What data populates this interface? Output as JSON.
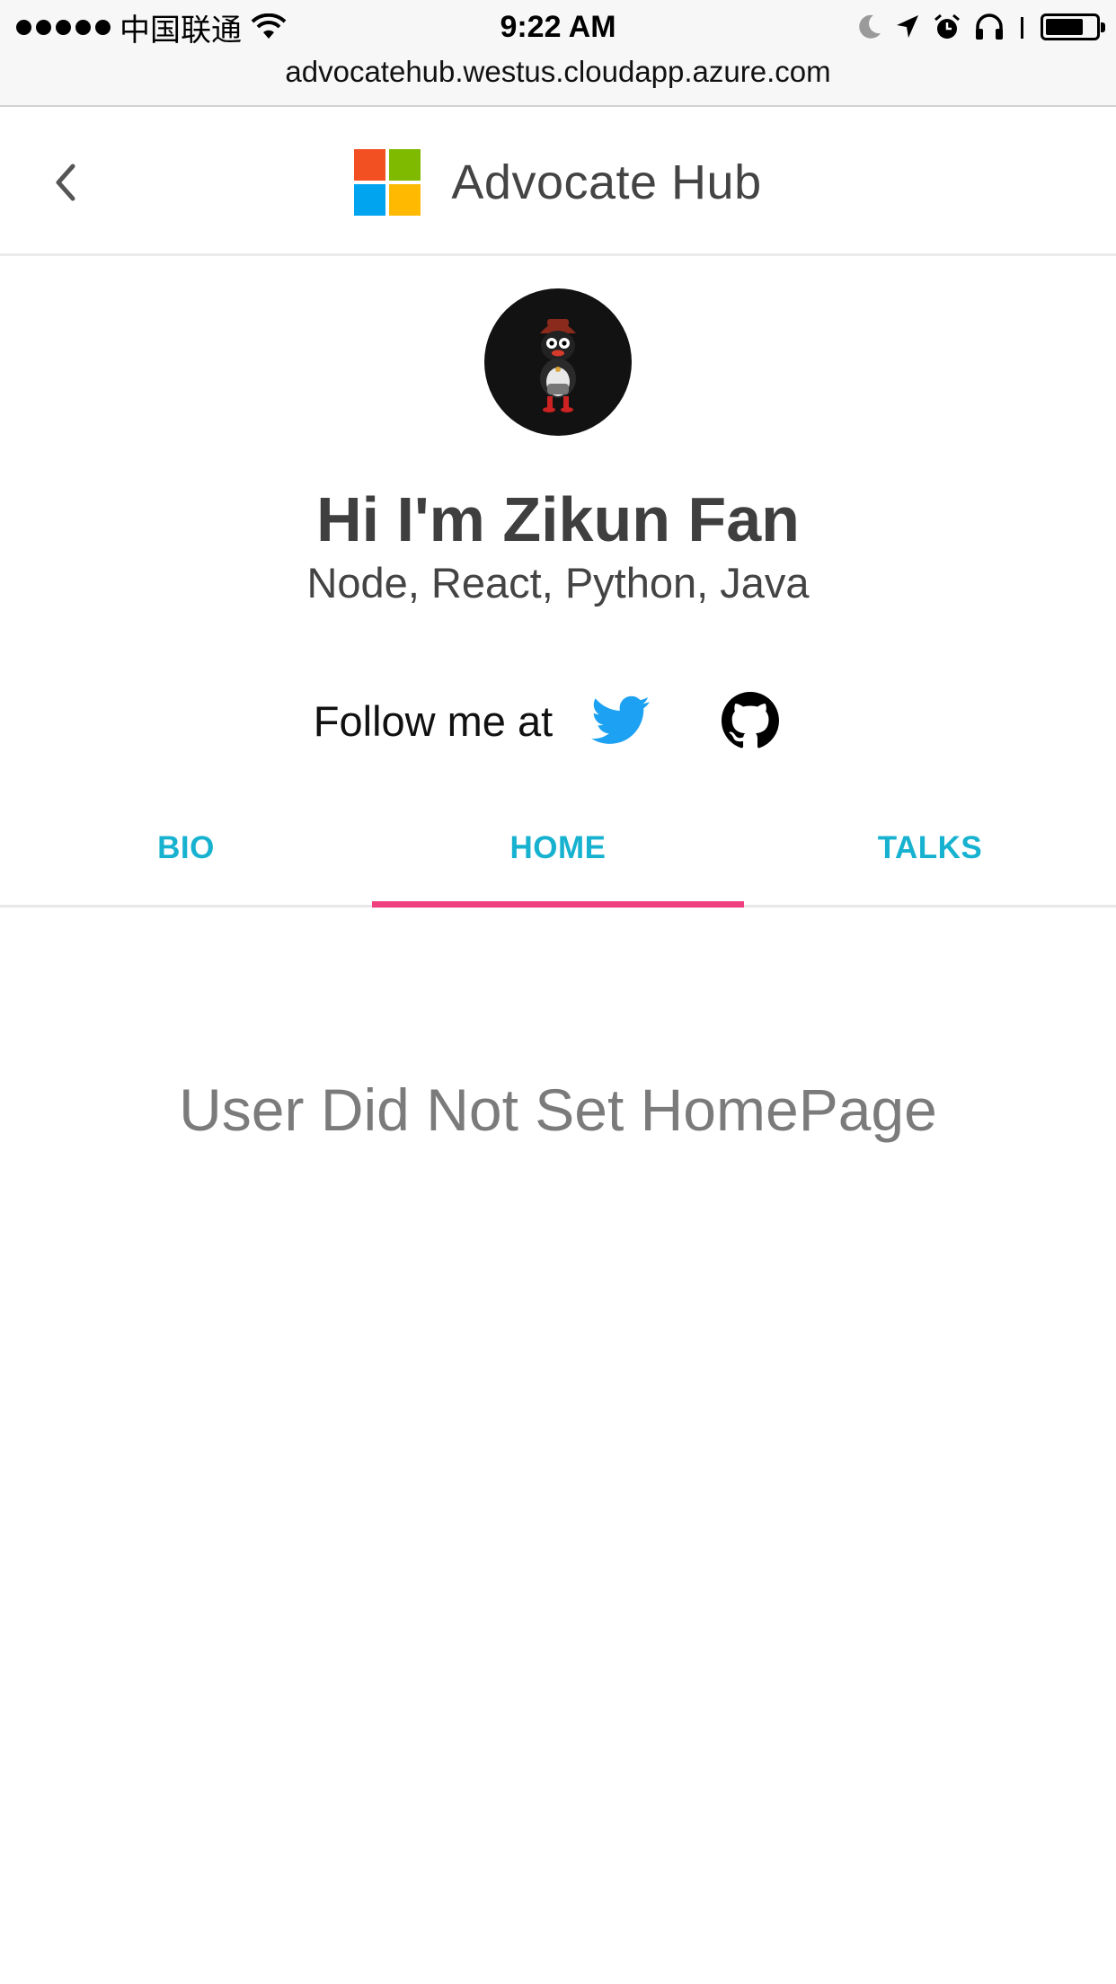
{
  "status_bar": {
    "carrier": "中国联通",
    "time": "9:22 AM",
    "url": "advocatehub.westus.cloudapp.azure.com",
    "battery_level": 0.75
  },
  "header": {
    "title": "Advocate Hub",
    "logo_colors": [
      "#f25022",
      "#7fba00",
      "#00a4ef",
      "#ffb900"
    ]
  },
  "profile": {
    "name": "Hi I'm Zikun Fan",
    "skills": "Node, React, Python, Java",
    "follow_label": "Follow me at",
    "social_links": [
      "twitter-icon",
      "github-icon"
    ]
  },
  "tabs": [
    {
      "label": "BIO",
      "active": false
    },
    {
      "label": "HOME",
      "active": true
    },
    {
      "label": "TALKS",
      "active": false
    }
  ],
  "content": {
    "message": "User Did Not Set HomePage"
  },
  "colors": {
    "tab_text": "#17b2d0",
    "tab_indicator": "#ef3f7e",
    "twitter": "#1da1f2"
  }
}
